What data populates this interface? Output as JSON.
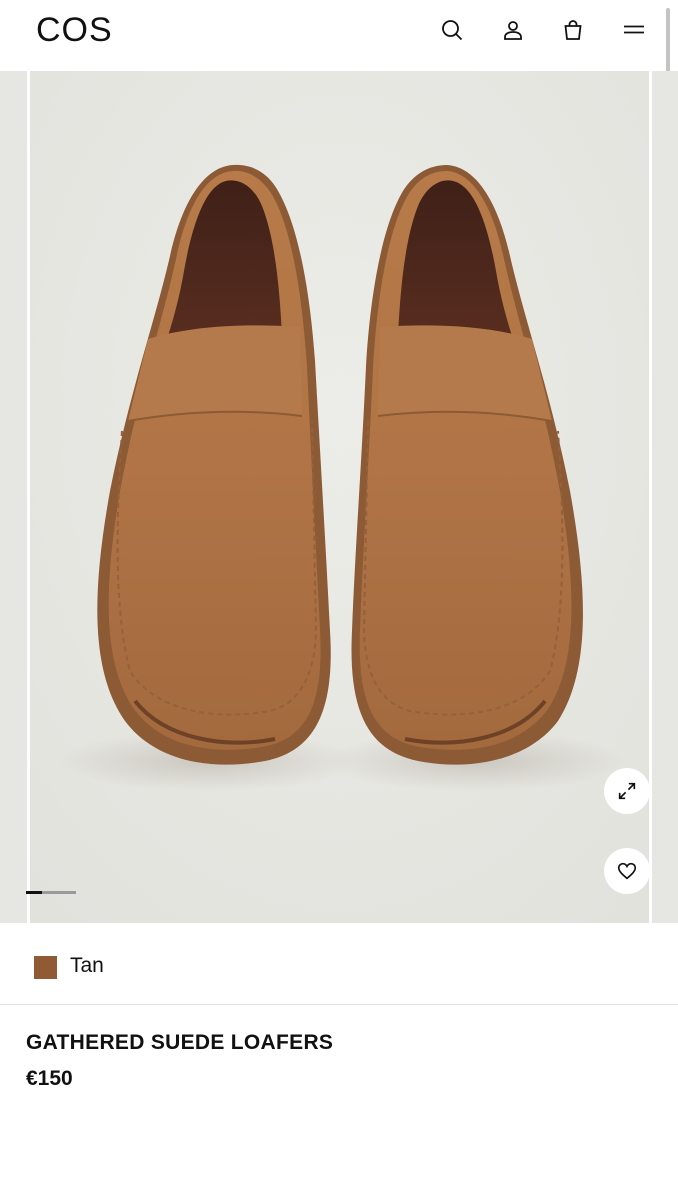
{
  "header": {
    "logo": "COS",
    "icons": [
      "search-icon",
      "account-icon",
      "bag-icon",
      "menu-icon"
    ]
  },
  "gallery": {
    "image_subject": "pair of tan suede loafers",
    "active_slide": 1,
    "buttons": [
      "expand-icon",
      "heart-icon"
    ]
  },
  "product": {
    "color_label": "Tan",
    "color_hex": "#8f5a34",
    "title": "GATHERED SUEDE LOAFERS",
    "price": "€150"
  },
  "colors": {
    "background": "#ffffff",
    "text": "#111111",
    "image_bg": "#e8e8e4"
  }
}
